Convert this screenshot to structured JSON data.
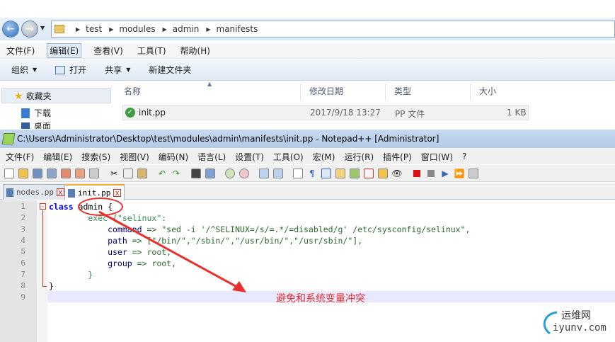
{
  "explorer": {
    "breadcrumb": [
      "test",
      "modules",
      "admin",
      "manifests"
    ],
    "menu": [
      "文件(F)",
      "编辑(E)",
      "查看(V)",
      "工具(T)",
      "帮助(H)"
    ],
    "commands": [
      "组织",
      "打开",
      "共享",
      "新建文件夹"
    ],
    "nav": {
      "favorites": "收藏夹",
      "downloads": "下载",
      "desktop": "桌面"
    },
    "columns": [
      "名称",
      "修改日期",
      "类型",
      "大小"
    ],
    "files": [
      {
        "name": "init.pp",
        "modified": "2017/9/18 13:27",
        "type": "PP 文件",
        "size": "1 KB"
      }
    ]
  },
  "notepad": {
    "title": "C:\\Users\\Administrator\\Desktop\\test\\modules\\admin\\manifests\\init.pp - Notepad++ [Administrator]",
    "menu": [
      "文件(F)",
      "编辑(E)",
      "搜索(S)",
      "视图(V)",
      "编码(N)",
      "语言(L)",
      "设置(T)",
      "工具(O)",
      "宏(M)",
      "运行(R)",
      "插件(P)",
      "窗口(W)",
      "?"
    ],
    "tabs": [
      {
        "label": "nodes.pp",
        "active": false
      },
      {
        "label": "init.pp",
        "active": true
      }
    ],
    "line_numbers": [
      "1",
      "2",
      "3",
      "4",
      "5",
      "6",
      "7",
      "8",
      "9"
    ],
    "code": {
      "l1_kw": "class",
      "l1_name": " admin {",
      "l2": "        exec {\"selinux\":",
      "l3_prop": "            command",
      "l3_val": " => \"sed -i '/^SELINUX=/s/=.*/=disabled/g' /etc/sysconfig/selinux\",",
      "l4_prop": "            path",
      "l4_val": " => [\"/bin/\",\"/sbin/\",\"/usr/bin/\",\"/usr/sbin/\"],",
      "l5_prop": "            user",
      "l5_val": " => root,",
      "l6_prop": "            group",
      "l6_val": " => root,",
      "l7": "        }",
      "l8": "}"
    },
    "annotation": "避免和系统变量冲突"
  },
  "watermark": {
    "brand": "运维网",
    "domain": "iyunv.com"
  },
  "colors": {
    "annotation": "#e2302b",
    "keyword": "#0000ff",
    "highlight_line": "#e8e8ff"
  }
}
